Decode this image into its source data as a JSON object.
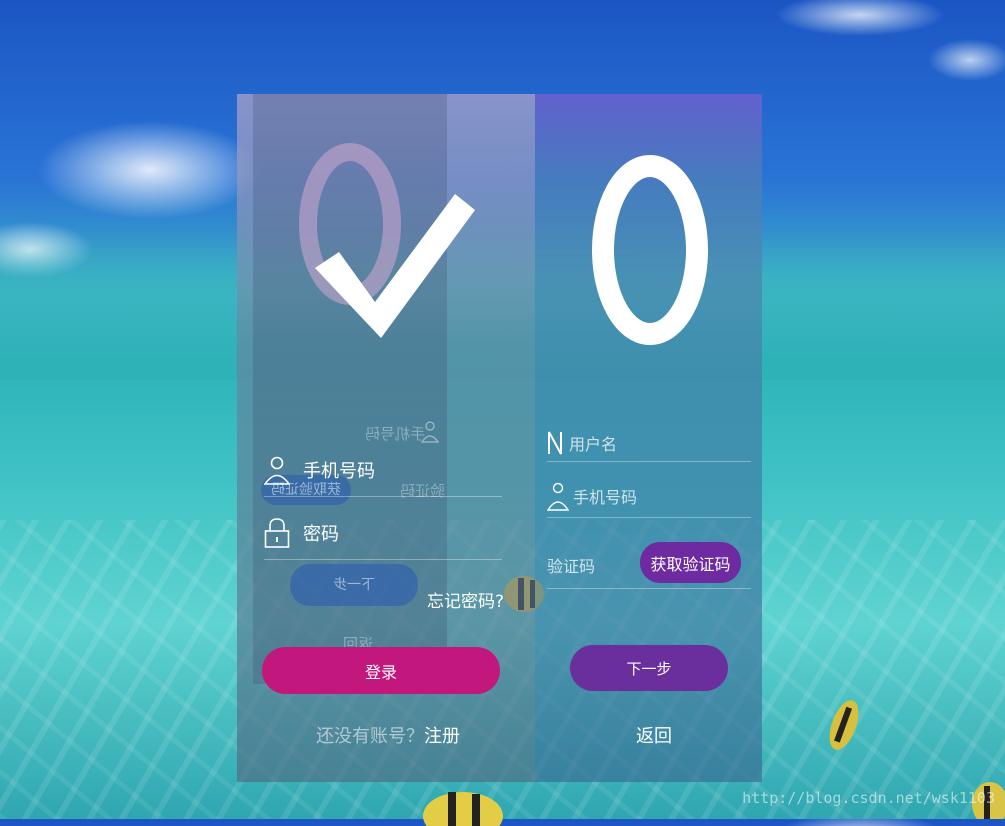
{
  "login": {
    "phone_label": "手机号码",
    "password_label": "密码",
    "forgot_label": "忘记密码?",
    "login_button": "登录",
    "no_account_text": "还没有账号？",
    "register_link": "注册"
  },
  "register": {
    "username_placeholder": "用户名",
    "phone_placeholder": "手机号码",
    "code_placeholder": "验证码",
    "get_code_button": "获取验证码",
    "next_button": "下一步",
    "back_link": "返回"
  },
  "ghost": {
    "phone": "手机号码",
    "code": "验证码",
    "get_code": "获取验证码",
    "next": "下一步",
    "back": "返回"
  },
  "watermark": "http://blog.csdn.net/wsk1103",
  "colors": {
    "login_button": "#c2187e",
    "register_buttons": "#6a2f9c",
    "panel_overlay": "rgba(90,120,150,0.42)"
  },
  "icons": [
    "check-logo-icon",
    "ring-logo-icon",
    "user-icon",
    "lock-icon",
    "n-icon"
  ]
}
